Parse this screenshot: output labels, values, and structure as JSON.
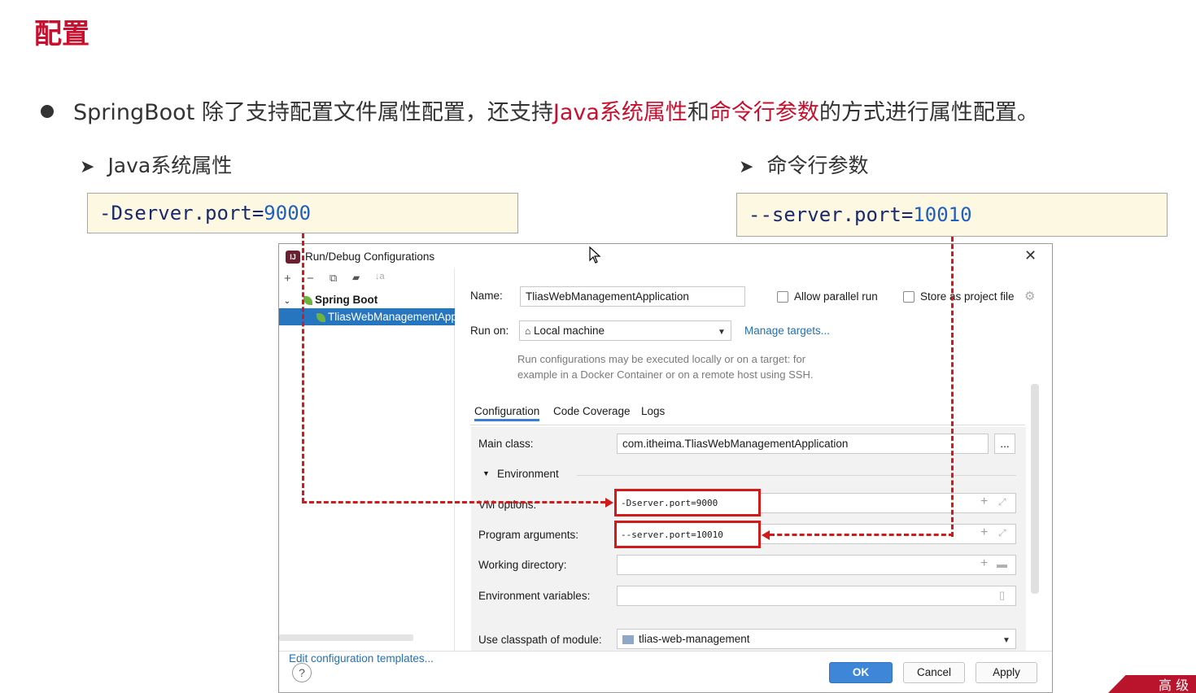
{
  "slide": {
    "title": "配置",
    "bullet": {
      "part1": "SpringBoot 除了支持配置文件属性配置，还支持",
      "java_sys": "Java系统属性",
      "and": "和",
      "cmd_args": "命令行参数",
      "part2": "的方式进行属性配置。"
    },
    "sub_left": "Java系统属性",
    "sub_right": "命令行参数",
    "code_left": {
      "prefix": "-Dserver.port=",
      "value": "9000"
    },
    "code_right": {
      "prefix": "--server.port=",
      "value": "10010"
    },
    "corner_text": "高 级"
  },
  "dialog": {
    "title": "Run/Debug Configurations",
    "toolbar": [
      "+",
      "−",
      "⧉",
      "▰",
      "↓a"
    ],
    "tree": {
      "group": "Spring Boot",
      "item": "TliasWebManagementApplication"
    },
    "edit_templates": "Edit configuration templates...",
    "name_label": "Name:",
    "name_value": "TliasWebManagementApplication",
    "allow_parallel": "Allow parallel run",
    "store_project": "Store as project file",
    "run_on_label": "Run on:",
    "run_on_value": "Local machine",
    "manage_targets": "Manage targets...",
    "hint_line1": "Run configurations may be executed locally or on a target: for",
    "hint_line2": "example in a Docker Container or on a remote host using SSH.",
    "tabs": [
      "Configuration",
      "Code Coverage",
      "Logs"
    ],
    "main_class_label": "Main class:",
    "main_class_value": "com.itheima.TliasWebManagementApplication",
    "browse_label": "...",
    "environment_label": "Environment",
    "vm_label": "VM options:",
    "vm_value": "-Dserver.port=9000",
    "prog_label": "Program arguments:",
    "prog_value": "--server.port=10010",
    "workdir_label": "Working directory:",
    "envvars_label": "Environment variables:",
    "classpath_label": "Use classpath of module:",
    "classpath_value": "tlias-web-management",
    "buttons": {
      "ok": "OK",
      "cancel": "Cancel",
      "apply": "Apply",
      "help": "?"
    }
  },
  "colors": {
    "accent_red": "#c8102e",
    "primary_blue": "#3d86d8",
    "code_bg": "#fcf8e1"
  }
}
